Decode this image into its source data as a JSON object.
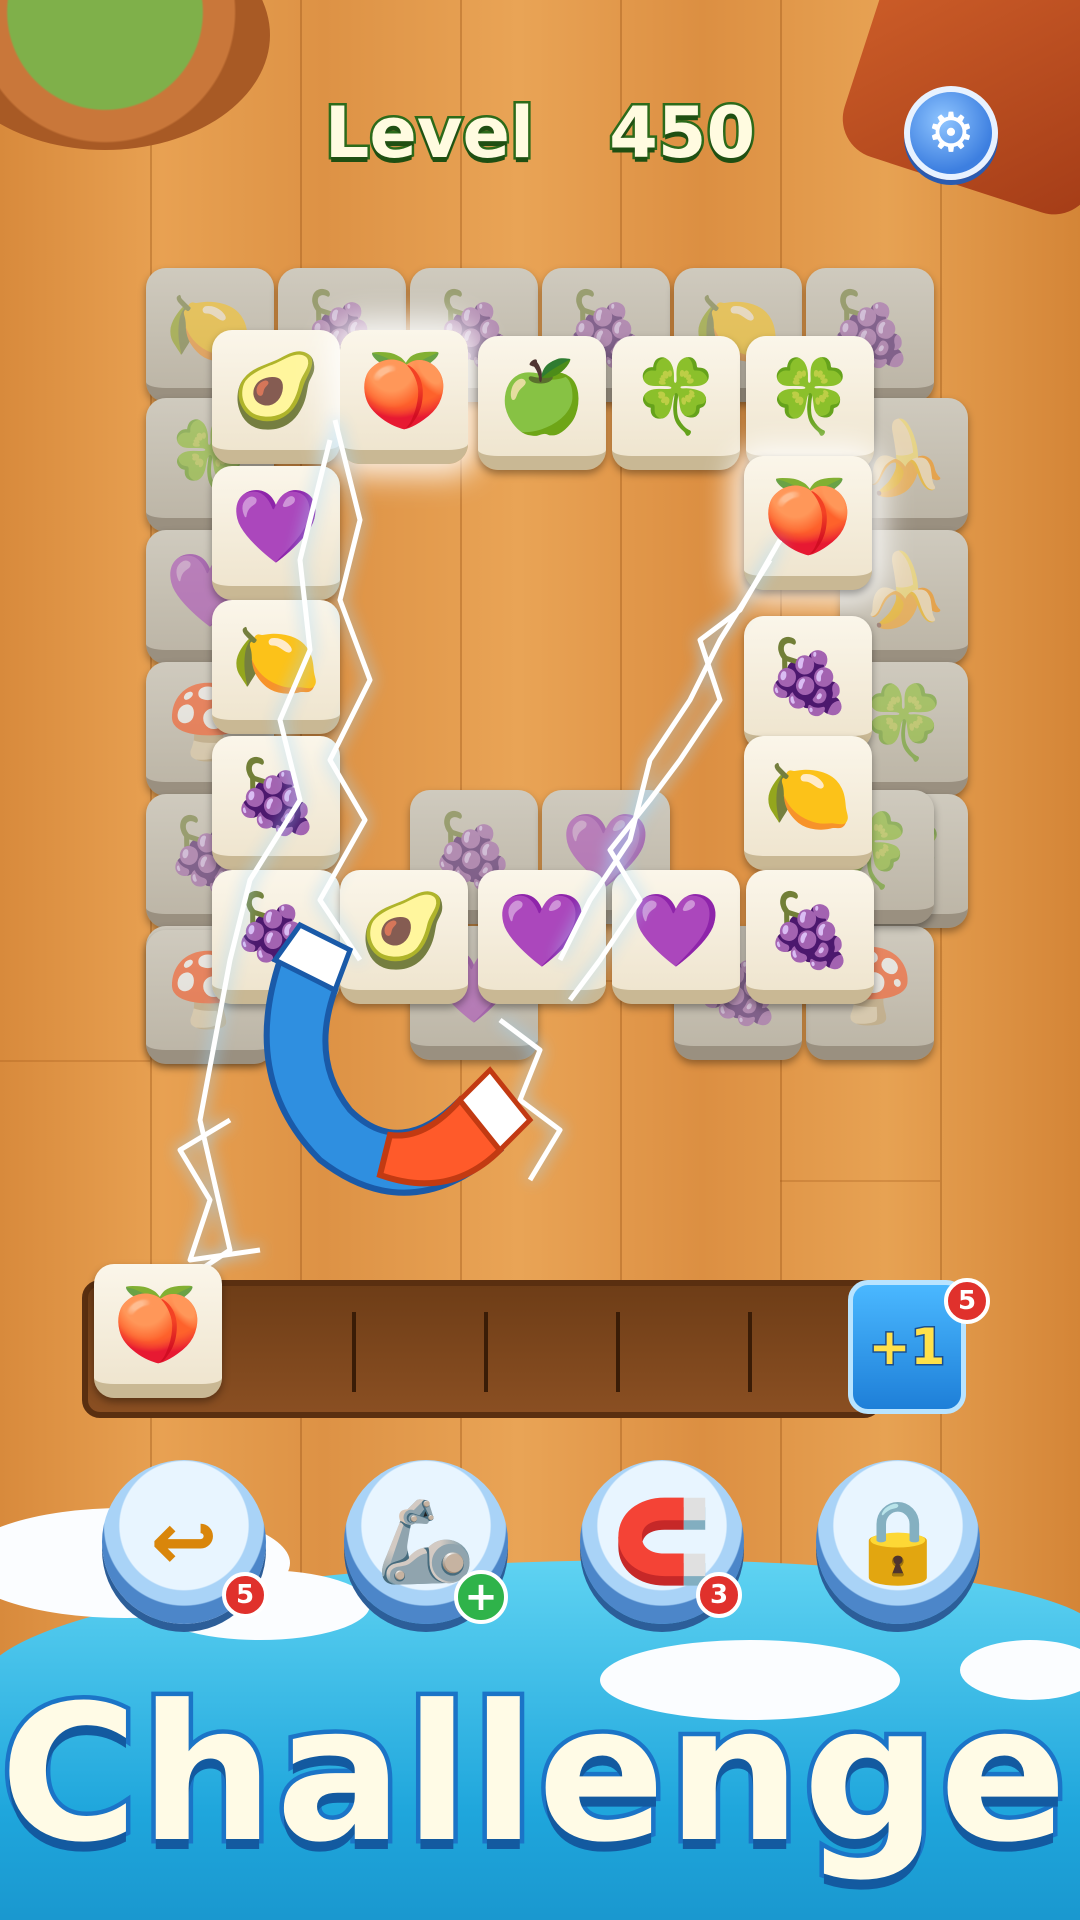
{
  "header": {
    "level_label": "Level",
    "level_number": "450",
    "settings_icon": "gear-icon"
  },
  "board": {
    "bottom_layer": [
      "🍋",
      "🍇",
      "🍇",
      "🍇",
      "🍋",
      "🍇",
      "🍀",
      "🍌",
      "💜",
      "🍌",
      "🍄",
      "🍀",
      "🍇",
      "🍀",
      "🍀",
      "🍄"
    ],
    "middle_layer": [
      "🍄",
      "🍇",
      "💜",
      "💜",
      "🍇",
      "🍀"
    ],
    "top_layer": [
      "🥑",
      "🍑",
      "🍏",
      "🍀",
      "🍀",
      "🍑",
      "💜",
      "🍋",
      "🍇",
      "🍇",
      "🍑",
      "🍋",
      "🍇",
      "🥑",
      "💜",
      "💜",
      "🍇"
    ]
  },
  "tray": {
    "slot_tiles": [
      "🍑"
    ],
    "add_slot": {
      "label": "+1",
      "count": "5"
    }
  },
  "powerups": [
    {
      "name": "undo",
      "icon": "undo-icon",
      "glyph": "↩",
      "count": "5"
    },
    {
      "name": "claw",
      "icon": "claw-icon",
      "glyph": "🦾",
      "plus": "+"
    },
    {
      "name": "magnet",
      "icon": "magnet-icon",
      "glyph": "🧲",
      "count": "3"
    },
    {
      "name": "locked",
      "icon": "lock-icon",
      "glyph": "🔒"
    }
  ],
  "banner": {
    "text": "Challenge!"
  },
  "colors": {
    "title_stroke": "#2c6b1a",
    "banner_stroke": "#1b74c7",
    "badge_red": "#e0312c"
  }
}
